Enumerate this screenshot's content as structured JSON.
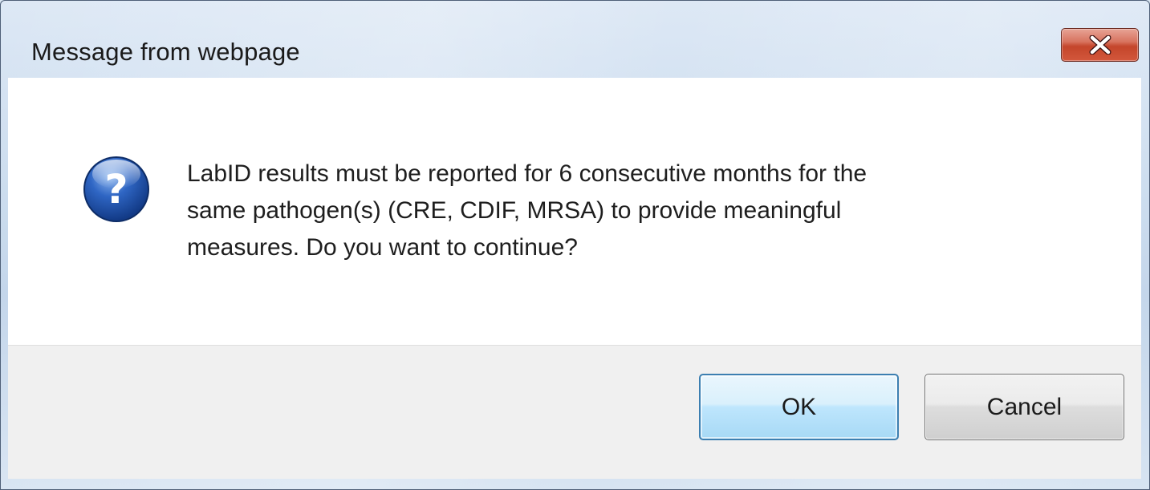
{
  "dialog": {
    "title": "Message from webpage",
    "close_icon": "close-x-icon",
    "message_icon": "question-icon",
    "message_lines": [
      "LabID results must be reported for 6 consecutive months for the",
      "same pathogen(s) (CRE, CDIF, MRSA) to provide meaningful",
      "measures. Do you want to continue?"
    ]
  },
  "buttons": {
    "ok_label": "OK",
    "cancel_label": "Cancel"
  },
  "colors": {
    "frame": "#c2d5ea",
    "close_button": "#c4452b",
    "ok_border": "#3c7fb1",
    "icon_blue": "#1f4fa3"
  }
}
